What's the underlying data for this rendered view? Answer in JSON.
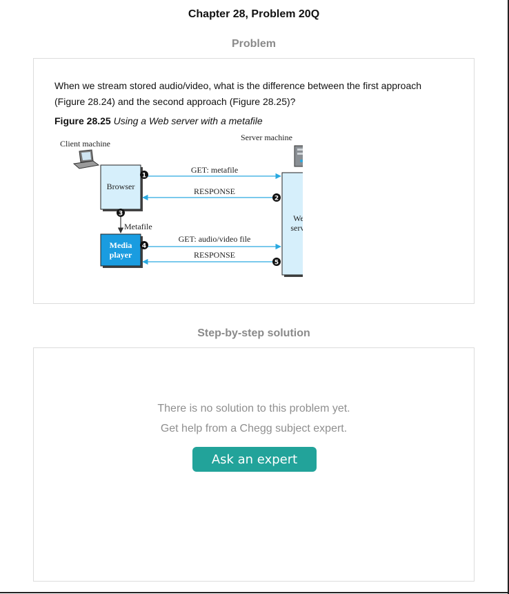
{
  "page": {
    "title": "Chapter 28, Problem 20Q"
  },
  "problem": {
    "heading": "Problem",
    "question_line1": "When we stream stored audio/video, what is the difference between the first approach",
    "question_line2": "(Figure 28.24) and the second approach (Figure 28.25)?",
    "figure_label": "Figure 28.25",
    "figure_caption": "Using a Web server with a metafile",
    "figure": {
      "client_label": "Client machine",
      "server_label": "Server machine",
      "browser_label": "Browser",
      "media_player_line1": "Media",
      "media_player_line2": "player",
      "web_server_line1": "Web",
      "web_server_line2": "server",
      "metafile_label": "Metafile",
      "messages": [
        {
          "step": "1",
          "text": "GET: metafile"
        },
        {
          "step": "2",
          "text": "RESPONSE"
        },
        {
          "step": "3",
          "text": ""
        },
        {
          "step": "4",
          "text": "GET: audio/video file"
        },
        {
          "step": "5",
          "text": "RESPONSE"
        }
      ],
      "colors": {
        "box_fill": "#d6effb",
        "media_fill": "#1a9ce0",
        "arrow": "#2aa9e0"
      }
    }
  },
  "solution": {
    "heading": "Step-by-step solution",
    "empty_line1": "There is no solution to this problem yet.",
    "empty_line2": "Get help from a Chegg subject expert.",
    "ask_button": "Ask an expert",
    "button_color": "#22a39a"
  }
}
